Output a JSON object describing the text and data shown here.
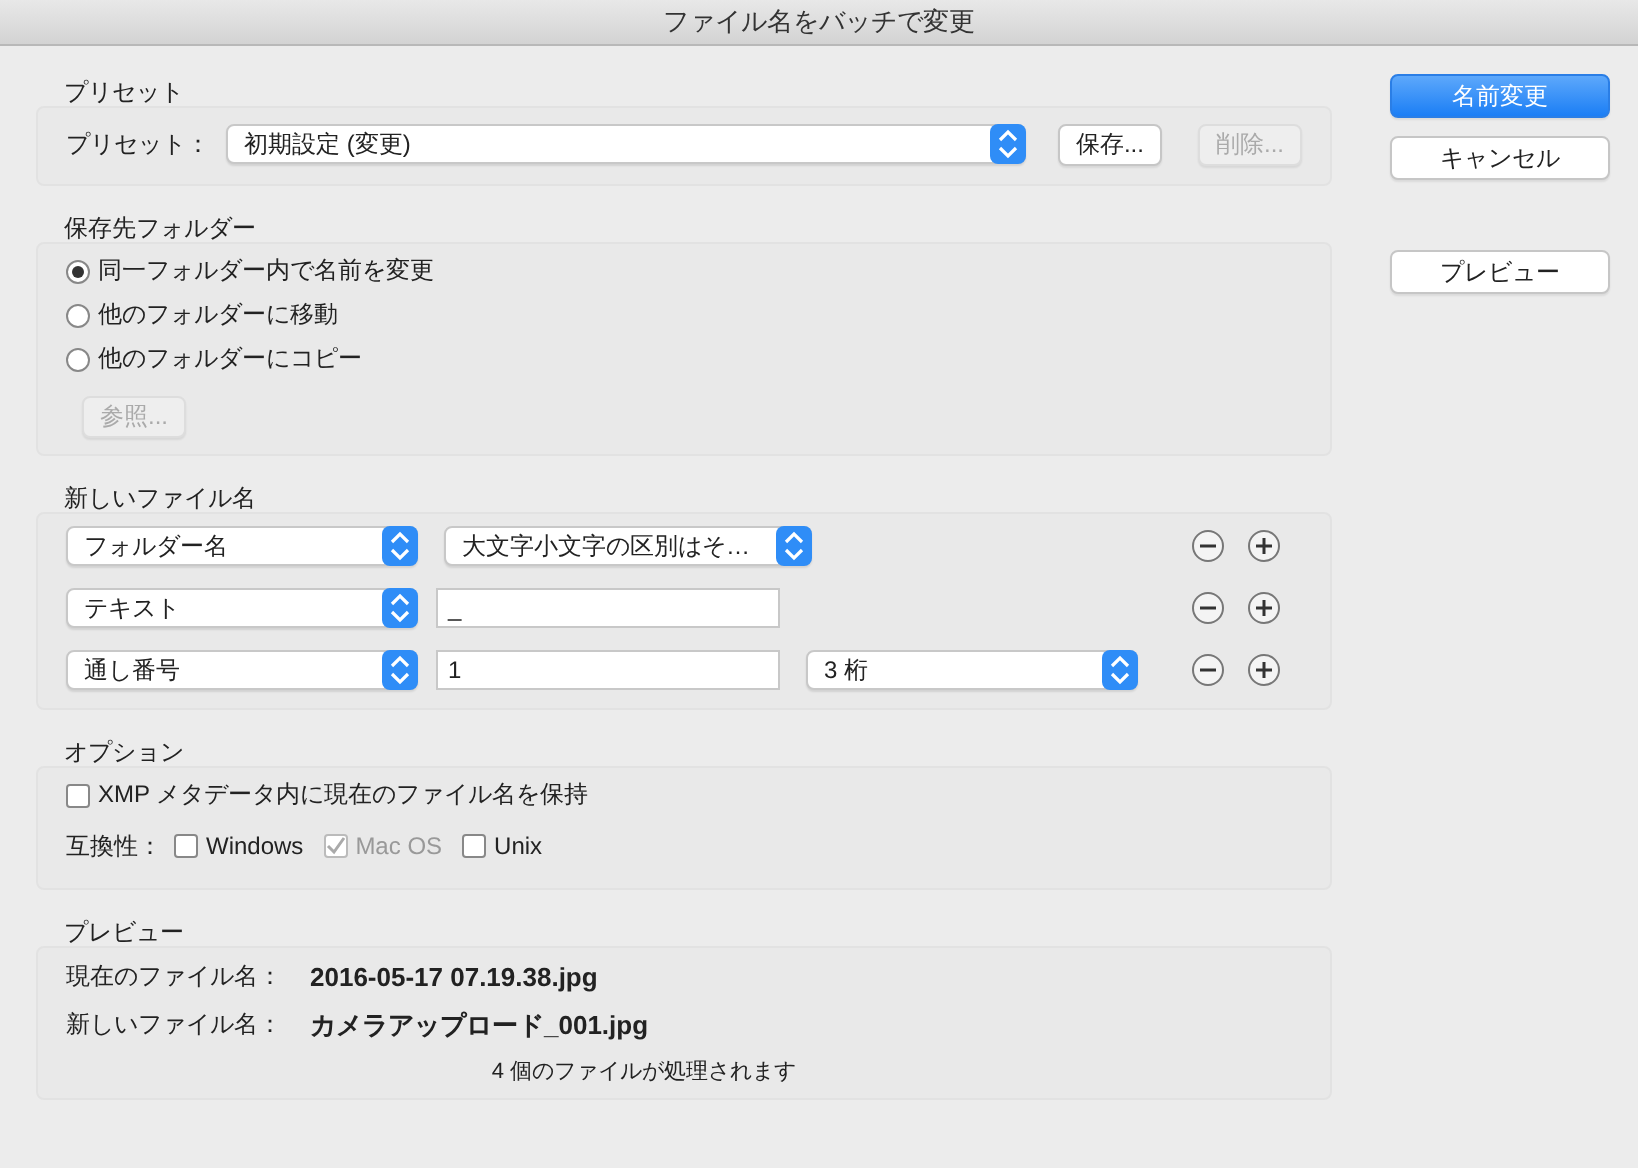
{
  "window": {
    "title": "ファイル名をバッチで変更"
  },
  "preset": {
    "heading": "プリセット",
    "label": "プリセット：",
    "value": "初期設定 (変更)",
    "buttons": [
      {
        "label": "保存...",
        "disabled": false
      },
      {
        "label": "削除...",
        "disabled": true
      }
    ]
  },
  "destination": {
    "heading": "保存先フォルダー",
    "options": [
      {
        "label": "同一フォルダー内で名前を変更",
        "selected": true
      },
      {
        "label": "他のフォルダーに移動",
        "selected": false
      },
      {
        "label": "他のフォルダーにコピー",
        "selected": false
      }
    ],
    "browse": {
      "label": "参照...",
      "disabled": true
    }
  },
  "naming": {
    "heading": "新しいファイル名",
    "rows": [
      {
        "controls": [
          {
            "kind": "popup",
            "value": "フォルダー名"
          },
          {
            "kind": "popup",
            "value": "大文字小文字の区別はそ…"
          }
        ]
      },
      {
        "controls": [
          {
            "kind": "popup",
            "value": "テキスト"
          },
          {
            "kind": "field",
            "value": "_"
          }
        ]
      },
      {
        "controls": [
          {
            "kind": "popup",
            "value": "通し番号"
          },
          {
            "kind": "field",
            "value": "1"
          },
          {
            "kind": "popup",
            "value": "3 桁"
          }
        ]
      }
    ]
  },
  "options": {
    "heading": "オプション",
    "keep_name": {
      "label": "XMP メタデータ内に現在のファイル名を保持",
      "checked": false
    },
    "compat_label": "互換性：",
    "compat": [
      {
        "label": "Windows",
        "checked": false,
        "disabled": false
      },
      {
        "label": "Mac OS",
        "checked": true,
        "disabled": true
      },
      {
        "label": "Unix",
        "checked": false,
        "disabled": false
      }
    ]
  },
  "preview": {
    "heading": "プレビュー",
    "current_label": "現在のファイル名：",
    "current_value": "2016-05-17 07.19.38.jpg",
    "new_label": "新しいファイル名：",
    "new_value": "カメラアップロード_001.jpg",
    "summary": "4 個のファイルが処理されます"
  },
  "actions": [
    {
      "label": "名前変更",
      "primary": true
    },
    {
      "label": "キャンセル",
      "primary": false
    },
    {
      "label": "プレビュー",
      "primary": false
    }
  ]
}
